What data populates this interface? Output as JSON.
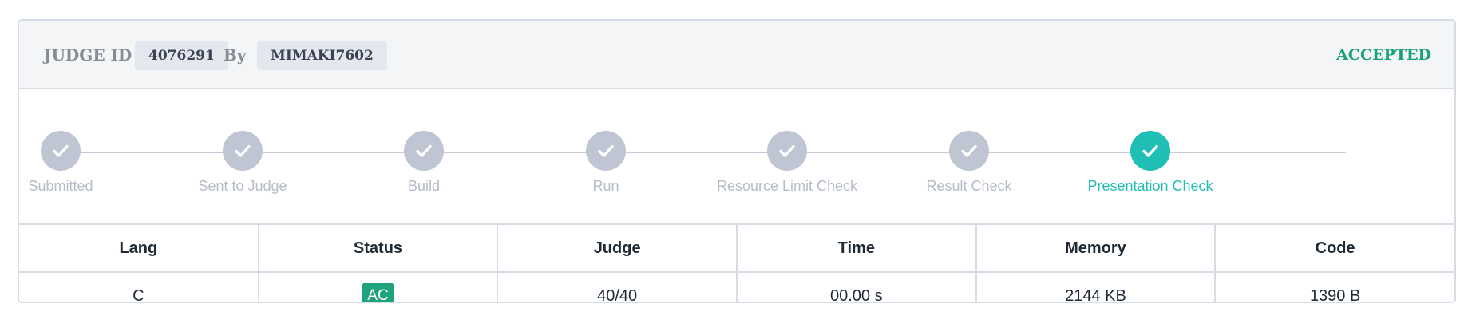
{
  "header": {
    "judge_id_label": "JUDGE ID :",
    "judge_id": "4076291",
    "by_label": "By",
    "user": "MIMAKI7602",
    "verdict": "ACCEPTED"
  },
  "steps": [
    {
      "label": "Submitted",
      "state": "done",
      "icon": "check-icon"
    },
    {
      "label": "Sent to Judge",
      "state": "done",
      "icon": "check-icon"
    },
    {
      "label": "Build",
      "state": "done",
      "icon": "check-icon"
    },
    {
      "label": "Run",
      "state": "done",
      "icon": "check-icon"
    },
    {
      "label": "Resource Limit Check",
      "state": "done",
      "icon": "check-icon"
    },
    {
      "label": "Result Check",
      "state": "done",
      "icon": "check-icon"
    },
    {
      "label": "Presentation Check",
      "state": "active",
      "icon": "check-icon"
    }
  ],
  "table": {
    "headers": [
      "Lang",
      "Status",
      "Judge",
      "Time",
      "Memory",
      "Code"
    ],
    "row": {
      "lang": "C",
      "status": "AC",
      "judge": "40/40",
      "time": "00.00 s",
      "memory": "2144 KB",
      "code": "1390 B"
    }
  },
  "colors": {
    "accent": "#1fbfb5",
    "accepted": "#17a07c",
    "ac_badge": "#1fa27e",
    "step_done": "#bfc5d3"
  }
}
